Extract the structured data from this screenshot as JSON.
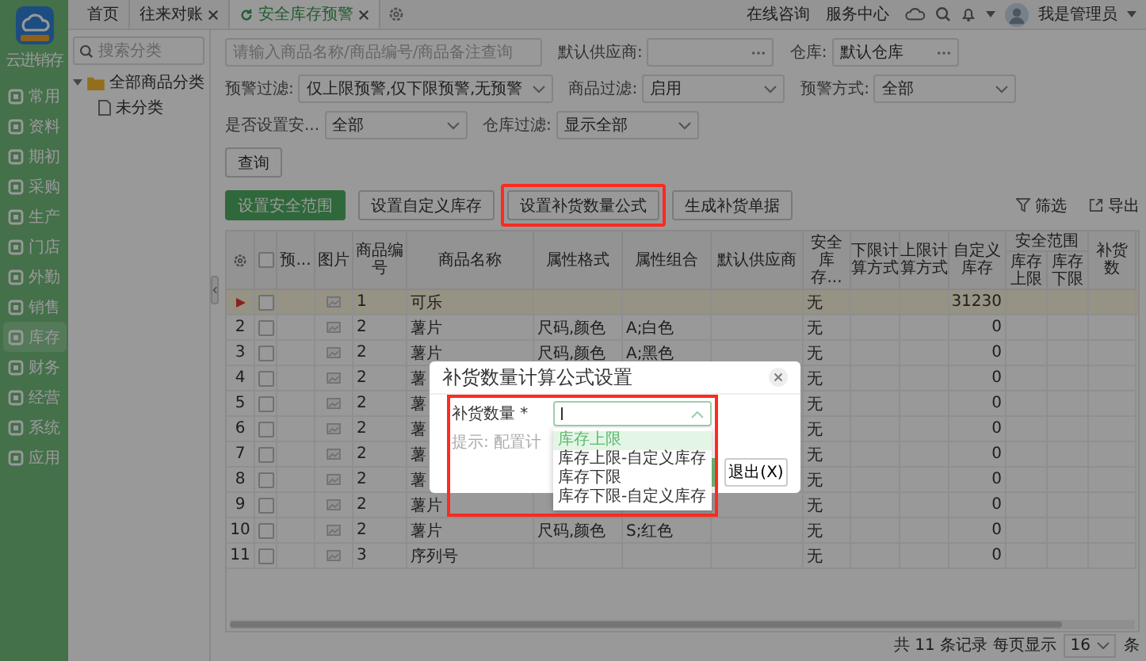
{
  "sidebar": {
    "app_name": "云进销存",
    "items": [
      {
        "label": "常用",
        "selected": false
      },
      {
        "label": "资料",
        "selected": false
      },
      {
        "label": "期初",
        "selected": false
      },
      {
        "label": "采购",
        "selected": false
      },
      {
        "label": "生产",
        "selected": false
      },
      {
        "label": "门店",
        "selected": false
      },
      {
        "label": "外勤",
        "selected": false
      },
      {
        "label": "销售",
        "selected": false
      },
      {
        "label": "库存",
        "selected": true
      },
      {
        "label": "财务",
        "selected": false
      },
      {
        "label": "经营",
        "selected": false
      },
      {
        "label": "系统",
        "selected": false
      },
      {
        "label": "应用",
        "selected": false
      }
    ]
  },
  "top_bar": {
    "tabs": [
      {
        "label": "首页",
        "closable": false,
        "selected": false
      },
      {
        "label": "往来对账",
        "closable": true,
        "selected": false
      },
      {
        "label": "安全库存预警",
        "closable": true,
        "selected": true
      }
    ],
    "links": [
      "在线咨询",
      "服务中心"
    ],
    "user": "我是管理员"
  },
  "category_panel": {
    "search_placeholder": "搜索分类",
    "tree": [
      {
        "label": "全部商品分类",
        "expanded": true,
        "children": [
          {
            "label": "未分类"
          }
        ]
      }
    ]
  },
  "filters": [
    {
      "kind": "search",
      "placeholder": "请输入商品名称/商品编号/商品备注查询"
    },
    {
      "kind": "picker",
      "label": "默认供应商:"
    },
    {
      "kind": "picker",
      "label": "仓库:",
      "value": "默认仓库"
    },
    {
      "kind": "select",
      "label": "预警过滤:",
      "value": "仅上限预警,仅下限预警,无预警"
    },
    {
      "kind": "select",
      "label": "商品过滤:",
      "value": "启用"
    },
    {
      "kind": "select",
      "label": "预警方式:",
      "value": "全部"
    },
    {
      "kind": "select",
      "label": "是否设置安...",
      "value": "全部"
    },
    {
      "kind": "select",
      "label": "仓库过滤:",
      "value": "显示全部"
    }
  ],
  "query_button": "查询",
  "toolbar": {
    "buttons": [
      {
        "label": "设置安全范围",
        "primary": true,
        "highlighted": false
      },
      {
        "label": "设置自定义库存",
        "primary": false,
        "highlighted": false
      },
      {
        "label": "设置补货数量公式",
        "primary": false,
        "highlighted": true
      },
      {
        "label": "生成补货单据",
        "primary": false,
        "highlighted": false
      }
    ],
    "actions": [
      {
        "kind": "filter",
        "label": "筛选"
      },
      {
        "kind": "export",
        "label": "导出"
      }
    ]
  },
  "table": {
    "all_checked": false,
    "columns": [
      {
        "label": "预..."
      },
      {
        "label": "图片"
      },
      {
        "label": "商品编号"
      },
      {
        "label": "商品名称"
      },
      {
        "label": "属性格式"
      },
      {
        "label": "属性组合"
      },
      {
        "label": "默认供应商"
      },
      {
        "label": "安全库存..."
      },
      {
        "label": "下限计算方式"
      },
      {
        "label": "上限计算方式"
      },
      {
        "label": "自定义库存"
      },
      {
        "label": "安全范围",
        "children": [
          {
            "label": "库存上限"
          },
          {
            "label": "库存下限"
          }
        ]
      },
      {
        "label": "补货数"
      }
    ],
    "rows": [
      {
        "current": true,
        "checked": false,
        "cells": [
          null,
          null,
          "1",
          "可乐",
          null,
          null,
          null,
          "无",
          null,
          null,
          "31230",
          null,
          null,
          null
        ]
      },
      {
        "current": false,
        "number": "2",
        "checked": false,
        "cells": [
          null,
          null,
          "2",
          "薯片",
          "尺码,颜色",
          "A;白色",
          null,
          "无",
          null,
          null,
          "0",
          null,
          null,
          null
        ]
      },
      {
        "current": false,
        "number": "3",
        "checked": false,
        "cells": [
          null,
          null,
          "2",
          "薯片",
          "尺码,颜色",
          "A;黑色",
          null,
          "无",
          null,
          null,
          "0",
          null,
          null,
          null
        ]
      },
      {
        "current": false,
        "number": "4",
        "checked": false,
        "cells": [
          null,
          null,
          "2",
          "薯",
          null,
          null,
          null,
          "无",
          null,
          null,
          "0",
          null,
          null,
          null
        ]
      },
      {
        "current": false,
        "number": "5",
        "checked": false,
        "cells": [
          null,
          null,
          "2",
          "薯",
          null,
          null,
          null,
          "无",
          null,
          null,
          "0",
          null,
          null,
          null
        ]
      },
      {
        "current": false,
        "number": "6",
        "checked": false,
        "cells": [
          null,
          null,
          "2",
          "薯",
          null,
          null,
          null,
          "无",
          null,
          null,
          "0",
          null,
          null,
          null
        ]
      },
      {
        "current": false,
        "number": "7",
        "checked": false,
        "cells": [
          null,
          null,
          "2",
          "薯",
          null,
          null,
          null,
          "无",
          null,
          null,
          "0",
          null,
          null,
          null
        ]
      },
      {
        "current": false,
        "number": "8",
        "checked": false,
        "cells": [
          null,
          null,
          "2",
          "薯",
          null,
          null,
          null,
          "无",
          null,
          null,
          "0",
          null,
          null,
          null
        ]
      },
      {
        "current": false,
        "number": "9",
        "checked": false,
        "cells": [
          null,
          null,
          "2",
          "薯片",
          null,
          null,
          null,
          "无",
          null,
          null,
          "0",
          null,
          null,
          null
        ]
      },
      {
        "current": false,
        "number": "10",
        "checked": false,
        "cells": [
          null,
          null,
          "2",
          "薯片",
          "尺码,颜色",
          "S;红色",
          null,
          "无",
          null,
          null,
          "0",
          null,
          null,
          null
        ]
      },
      {
        "current": false,
        "number": "11",
        "checked": false,
        "cells": [
          null,
          null,
          "3",
          "序列号",
          null,
          null,
          null,
          "无",
          null,
          null,
          "0",
          null,
          null,
          null
        ]
      }
    ]
  },
  "footer": {
    "summary": "共 11 条记录 每页显示",
    "page_size": "16",
    "unit": "条"
  },
  "dialog": {
    "title": "补货数量计算公式设置",
    "field_label": "补货数量 *",
    "hint": "提示: 配置计",
    "cancel_button": "退出(X)",
    "highlighted": true,
    "options": [
      {
        "label": "库存上限",
        "selected": true
      },
      {
        "label": "库存上限-自定义库存",
        "selected": false
      },
      {
        "label": "库存下限",
        "selected": false
      },
      {
        "label": "库存下限-自定义库存",
        "selected": false
      }
    ]
  }
}
